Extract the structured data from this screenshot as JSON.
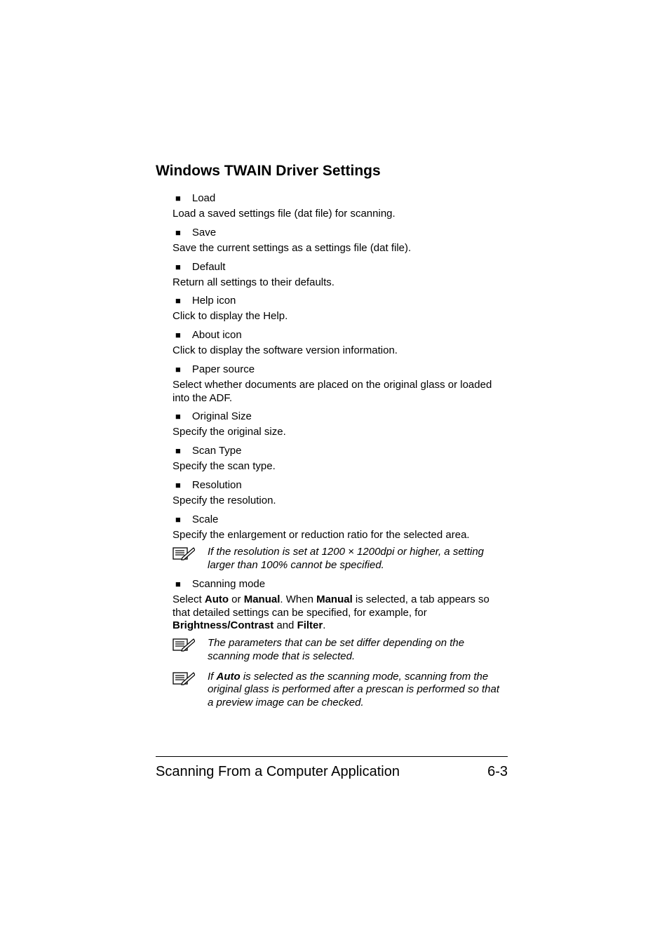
{
  "heading": "Windows TWAIN Driver Settings",
  "items": [
    {
      "label": "Load",
      "desc": "Load a saved settings file (dat file) for scanning."
    },
    {
      "label": "Save",
      "desc": "Save the current settings as a settings file (dat file)."
    },
    {
      "label": "Default",
      "desc": "Return all settings to their defaults."
    },
    {
      "label": "Help icon",
      "desc": "Click to display the Help."
    },
    {
      "label": "About icon",
      "desc": "Click to display the software version information."
    },
    {
      "label": "Paper source",
      "desc": "Select whether documents are placed on the original glass or loaded into the ADF."
    },
    {
      "label": "Original Size",
      "desc": "Specify the original size."
    },
    {
      "label": "Scan Type",
      "desc": "Specify the scan type."
    },
    {
      "label": "Resolution",
      "desc": "Specify the resolution."
    },
    {
      "label": "Scale",
      "desc": "Specify the enlargement or reduction ratio for the selected area."
    }
  ],
  "note1": "If the resolution is set at 1200 × 1200dpi or higher, a setting larger than 100% cannot be specified.",
  "scanning_mode": {
    "label": "Scanning mode",
    "p1a": "Select ",
    "p1b": "Auto",
    "p1c": " or ",
    "p1d": "Manual",
    "p1e": ". When ",
    "p1f": "Manual",
    "p1g": " is selected, a tab appears so that detailed settings can be specified, for example, for ",
    "p1h": "Brightness/Contrast",
    "p1i": " and ",
    "p1j": "Filter",
    "p1k": "."
  },
  "note2": "The parameters that can be set differ depending on the scanning mode that is selected.",
  "note3a": "If ",
  "note3b": "Auto",
  "note3c": " is selected as the scanning mode, scanning from the original glass is performed after a prescan is performed so that a preview image can be checked.",
  "footer": {
    "left": "Scanning From a Computer Application",
    "right": "6-3"
  }
}
